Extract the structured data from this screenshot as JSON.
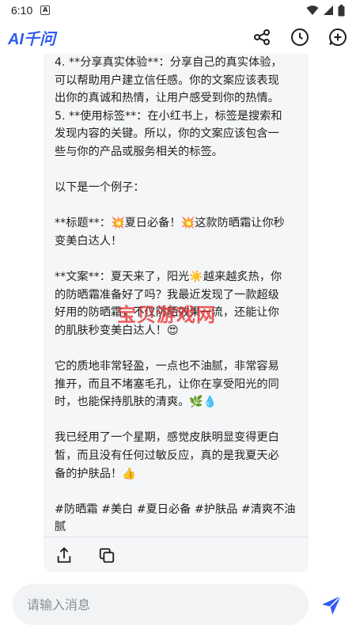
{
  "status_bar": {
    "time": "6:10",
    "notification_icon": "a-badge-icon",
    "icons": [
      "wifi-icon",
      "signal-icon",
      "battery-icon"
    ]
  },
  "header": {
    "logo_text": "AI千问",
    "actions": [
      "share-nodes-icon",
      "history-clock-icon",
      "new-chat-plus-icon"
    ],
    "accent_color": "#2f5cf0"
  },
  "message": {
    "lines": [
      "4. **分享真实体验**：分享自己的真实体验，",
      "可以帮助用户建立信任感。你的文案应该表现",
      "出你的真诚和热情，让用户感受到你的热情。",
      "5. **使用标签**：在小红书上，标签是搜索和",
      "发现内容的关键。所以，你的文案应该包含一",
      "些与你的产品或服务相关的标签。",
      "",
      "以下是一个例子：",
      "",
      "**标题**：💥夏日必备！💥这款防晒霜让你秒",
      "变美白达人！",
      "",
      "**文案**：夏天来了，阳光☀️越来越炙热，你",
      "的防晒霜准备好了吗？我最近发现了一款超级",
      "好用的防晒霜，不仅防晒效果一流，还能让你",
      "的肌肤秒变美白达人！😍",
      "",
      "它的质地非常轻盈，一点也不油腻，非常容易",
      "推开，而且不堵塞毛孔，让你在享受阳光的同",
      "时，也能保持肌肤的清爽。🌿💧",
      "",
      "我已经用了一个星期，感觉皮肤明显变得更白",
      "皙，而且没有任何过敏反应，真的是我夏天必",
      "备的护肤品！👍",
      "",
      "#防晒霜 #美白 #夏日必备 #护肤品 #清爽不油",
      "腻"
    ],
    "actions": [
      "share-upload-icon",
      "copy-icon"
    ]
  },
  "watermark": {
    "text": "宝贝游戏网"
  },
  "input": {
    "placeholder": "请输入消息",
    "value": ""
  },
  "send": {
    "icon": "send-paper-plane-icon",
    "color": "#2f5cf0"
  }
}
